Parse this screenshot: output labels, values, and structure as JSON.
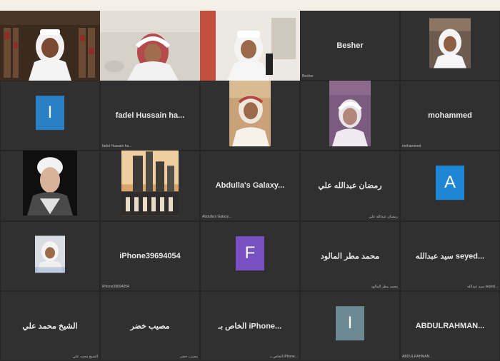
{
  "meeting": {
    "tiles": [
      {
        "type": "video",
        "display_name": "",
        "tag": ""
      },
      {
        "type": "video",
        "display_name": "",
        "tag": ""
      },
      {
        "type": "video",
        "display_name": "",
        "tag": ""
      },
      {
        "type": "name",
        "display_name": "Besher",
        "tag": "Besher"
      },
      {
        "type": "video",
        "display_name": "",
        "tag": ""
      },
      {
        "type": "avatar",
        "display_name": "I",
        "avatar_color": "#2b7fc3",
        "tag": ""
      },
      {
        "type": "name",
        "display_name": "fadel Hussain ha...",
        "tag": "fadel Hussain ha..."
      },
      {
        "type": "photo",
        "display_name": "",
        "tag": ""
      },
      {
        "type": "photo",
        "display_name": "",
        "tag": ""
      },
      {
        "type": "name",
        "display_name": "mohammed",
        "tag": "mohammed"
      },
      {
        "type": "photo",
        "display_name": "",
        "tag": ""
      },
      {
        "type": "photo",
        "display_name": "",
        "tag": ""
      },
      {
        "type": "name",
        "display_name": "Abdulla's Galaxy...",
        "tag": "Abdulla's Galaxy..."
      },
      {
        "type": "name",
        "display_name": "رمضان عبدالله علي",
        "tag": "رمضان عبدالله علي"
      },
      {
        "type": "avatar",
        "display_name": "A",
        "avatar_color": "#1f86d6",
        "tag": ""
      },
      {
        "type": "photo",
        "display_name": "",
        "tag": ""
      },
      {
        "type": "name",
        "display_name": "iPhone39694054",
        "tag": "iPhone39694054"
      },
      {
        "type": "avatar",
        "display_name": "F",
        "avatar_color": "#7a4fc2",
        "tag": ""
      },
      {
        "type": "name",
        "display_name": "محمد مطر المالود",
        "tag": "محمد مطر المالود"
      },
      {
        "type": "name",
        "display_name": "...seyed سيد عبدالله",
        "tag": "...seyed سيد عبدالله"
      },
      {
        "type": "name",
        "display_name": "الشيخ محمد علي",
        "tag": "الشيخ محمد علي"
      },
      {
        "type": "name",
        "display_name": "مصيب خضر",
        "tag": "مصيب خضر"
      },
      {
        "type": "name",
        "display_name": "...iPhone الخاص بـ",
        "tag": "...iPhone الخاص بـ"
      },
      {
        "type": "avatar",
        "display_name": "I",
        "avatar_color": "#6b8a92",
        "tag": ""
      },
      {
        "type": "name",
        "display_name": "ABDULRAHMAN...",
        "tag": "ABDULRAHMAN..."
      }
    ]
  },
  "colors": {
    "background": "#2a2a2a",
    "page_top": "#f4f0e8"
  },
  "icons": [
    "muted-mic-icon"
  ]
}
